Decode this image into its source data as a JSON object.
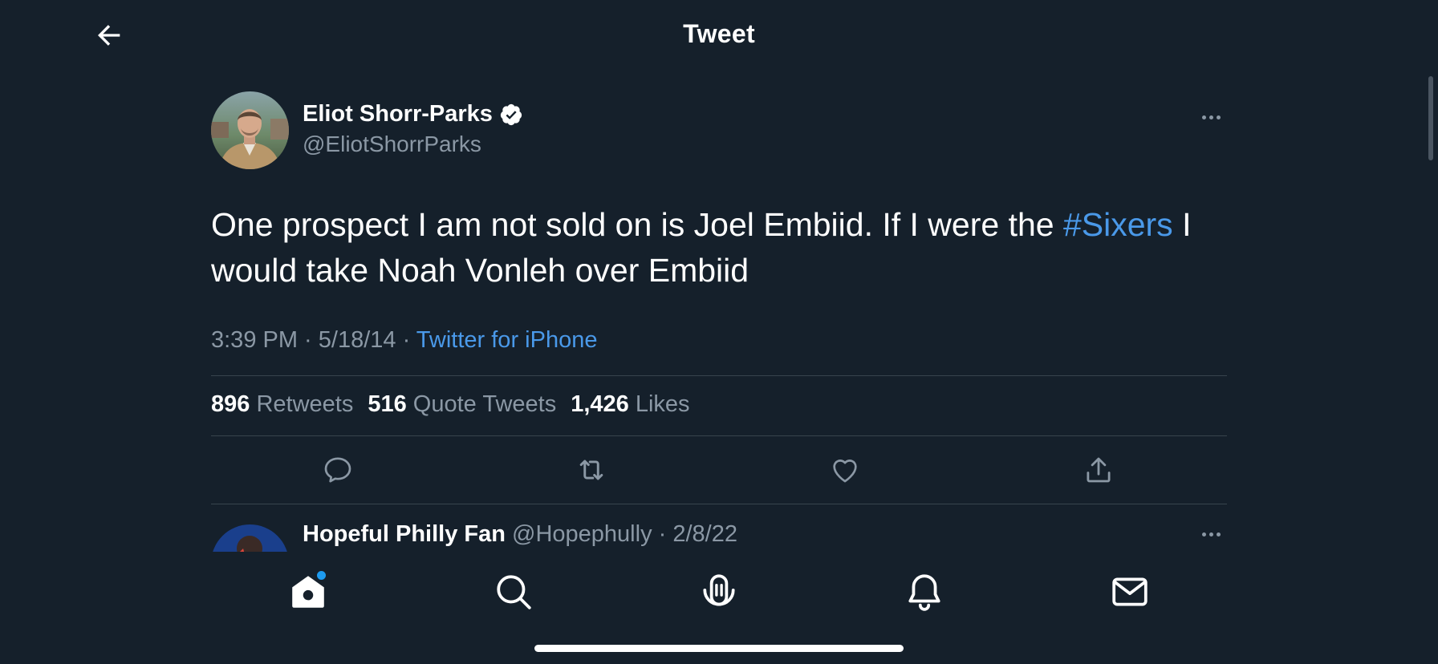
{
  "header": {
    "title": "Tweet",
    "back_icon": "arrow-left-icon"
  },
  "tweet": {
    "author": {
      "name": "Eliot Shorr-Parks",
      "handle": "@EliotShorrParks",
      "verified": true
    },
    "text_before": "One prospect I am not sold on is Joel Embiid. If I were the ",
    "hashtag": "#Sixers",
    "text_after": " I would take Noah Vonleh over Embiid",
    "time": "3:39 PM",
    "sep1": " · ",
    "date": "5/18/14",
    "sep2": " · ",
    "source": "Twitter for iPhone",
    "stats": {
      "retweets_count": "896",
      "retweets_label": "Retweets",
      "quotes_count": "516",
      "quotes_label": "Quote Tweets",
      "likes_count": "1,426",
      "likes_label": "Likes"
    },
    "actions": [
      "reply-icon",
      "retweet-icon",
      "like-icon",
      "share-icon"
    ]
  },
  "reply": {
    "name": "Hopeful Philly Fan",
    "handle": "@Hopephully",
    "sep": " · ",
    "date": "2/8/22"
  },
  "tabbar": {
    "items": [
      "home-icon",
      "search-icon",
      "spaces-icon",
      "notifications-icon",
      "messages-icon"
    ],
    "home_has_new": true
  },
  "colors": {
    "background": "#15202b",
    "text": "#ffffff",
    "secondary": "#8b98a5",
    "link": "#4a99e9",
    "divider": "#38444d"
  }
}
